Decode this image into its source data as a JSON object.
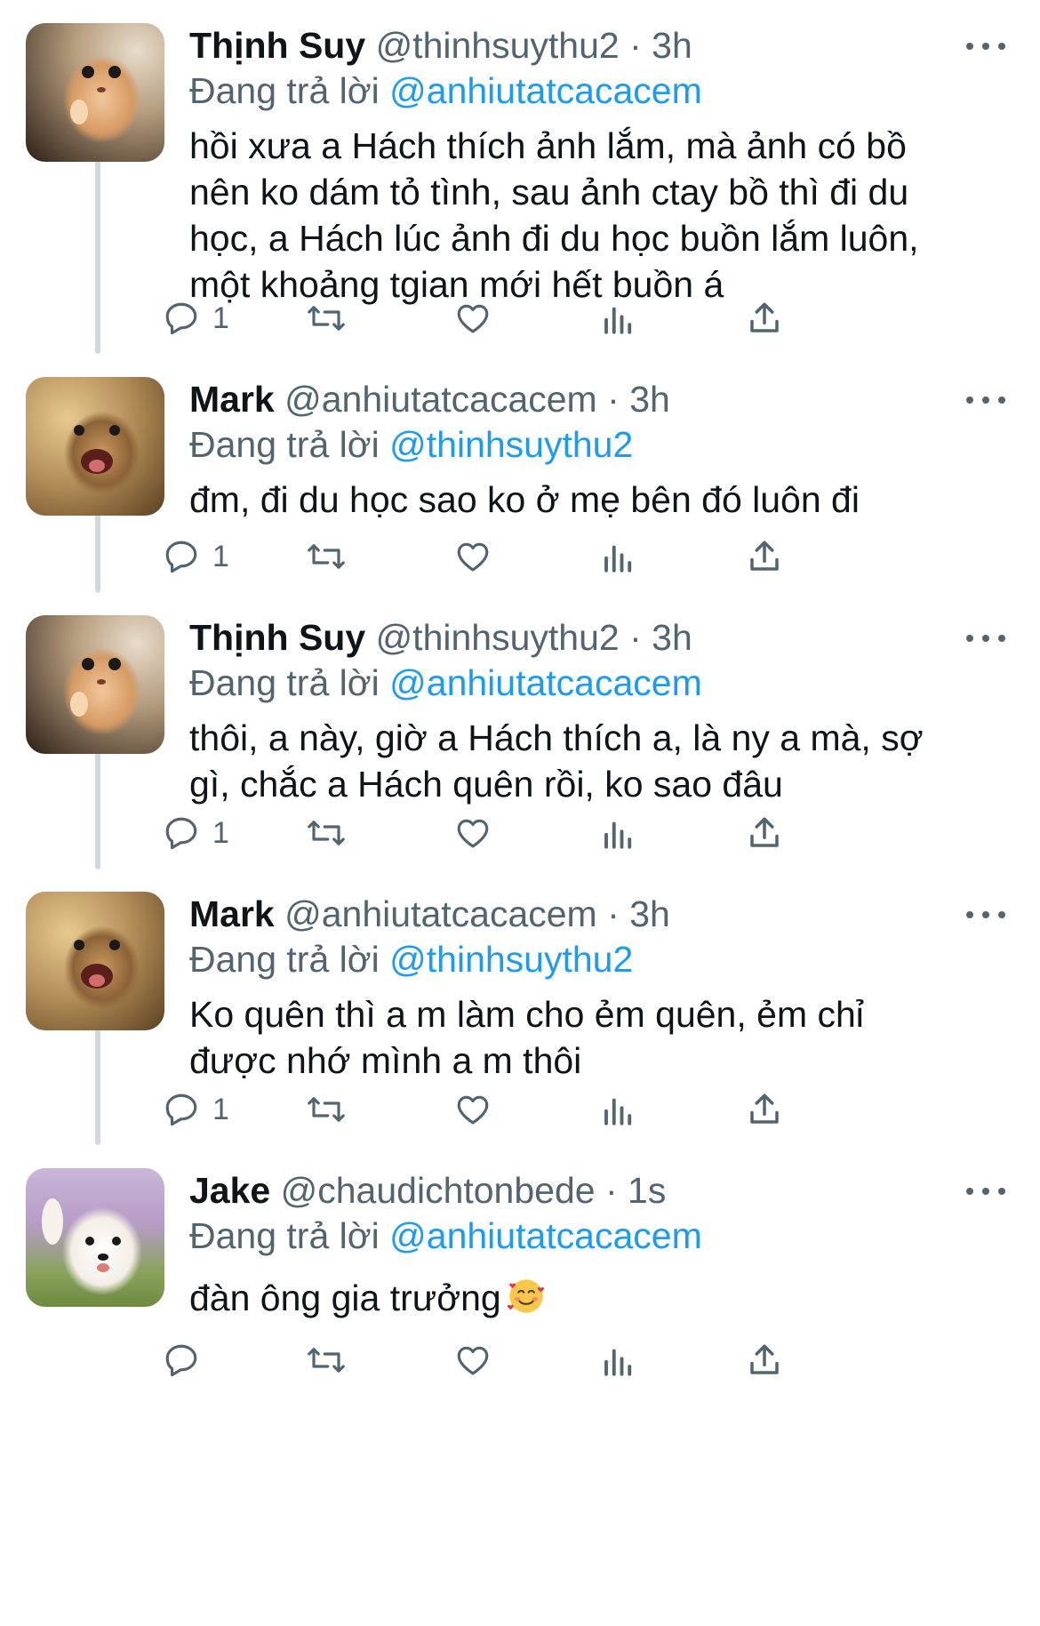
{
  "tweets": [
    {
      "name": "Thịnh Suy",
      "handle": "@thinhsuythu2",
      "time": "3h",
      "reply_label": "Đang trả lời",
      "reply_to": "@anhiutatcacacem",
      "text": [
        "hồi xưa a Hách thích ảnh lắm, mà ảnh có bồ",
        "nên ko dám tỏ tình, sau ảnh ctay bồ thì đi du",
        "học, a Hách lúc ảnh đi du học buồn lắm luôn,",
        "một khoảng tgian mới hết buồn á"
      ],
      "reply_count": "1",
      "avatar": "hamster-avatar"
    },
    {
      "name": "Mark",
      "handle": "@anhiutatcacacem",
      "time": "3h",
      "reply_label": "Đang trả lời",
      "reply_to": "@thinhsuythu2",
      "text": [
        "đm, đi du học sao ko ở mẹ bên đó luôn đi"
      ],
      "reply_count": "1",
      "avatar": "cheetah-avatar"
    },
    {
      "name": "Thịnh Suy",
      "handle": "@thinhsuythu2",
      "time": "3h",
      "reply_label": "Đang trả lời",
      "reply_to": "@anhiutatcacacem",
      "text": [
        "thôi, a này, giờ a Hách thích a, là ny a mà, sợ",
        "gì, chắc a Hách quên rồi, ko sao đâu"
      ],
      "reply_count": "1",
      "avatar": "hamster-avatar"
    },
    {
      "name": "Mark",
      "handle": "@anhiutatcacacem",
      "time": "3h",
      "reply_label": "Đang trả lời",
      "reply_to": "@thinhsuythu2",
      "text": [
        "Ko quên thì a m làm cho ẻm quên, ẻm chỉ",
        "được nhớ mình a m thôi"
      ],
      "reply_count": "1",
      "avatar": "cheetah-avatar"
    },
    {
      "name": "Jake",
      "handle": "@chaudichtonbede",
      "time": "1s",
      "reply_label": "Đang trả lời",
      "reply_to": "@anhiutatcacacem",
      "text": [
        "đàn ông gia trưởng"
      ],
      "text_emoji": "smiling-face-with-hearts",
      "reply_count": "",
      "avatar": "dog-avatar"
    }
  ],
  "separator": "·",
  "colors": {
    "accent": "#1d9bf0",
    "muted": "#536471",
    "text": "#0f1419",
    "thread_line": "#cfd9de"
  }
}
